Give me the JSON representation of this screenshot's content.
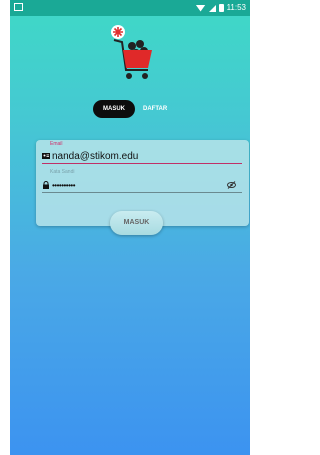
{
  "status_bar": {
    "time": "11:53"
  },
  "tabs": {
    "login": "MASUK",
    "register": "DAFTAR"
  },
  "form": {
    "email_label": "Email",
    "email_value": "nanda@stikom.edu",
    "password_label": "Kata Sandi",
    "password_value": "••••••••••"
  },
  "submit_label": "MASUK",
  "colors": {
    "status_bar": "#1aa996",
    "accent": "#d0306b",
    "active_tab": "#0d0d0d"
  }
}
